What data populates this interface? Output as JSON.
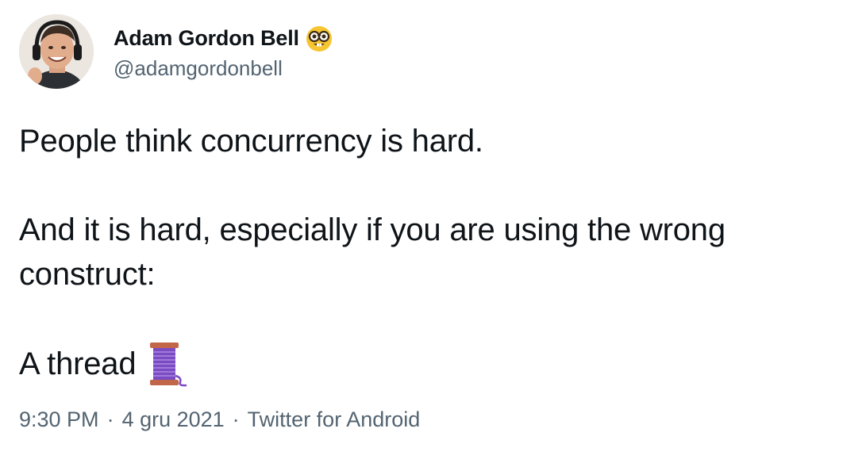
{
  "author": {
    "display_name": "Adam Gordon Bell",
    "handle": "@adamgordonbell",
    "badge_icon": "nerd-face-emoji-icon"
  },
  "tweet": {
    "line1": "People think concurrency is hard.",
    "line2": "And it is hard, especially if you are using the wrong construct:",
    "line3": "A thread",
    "line3_icon": "thread-spool-emoji-icon"
  },
  "meta": {
    "time": "9:30 PM",
    "date": "4 gru 2021",
    "source": "Twitter for Android",
    "separator": "·"
  },
  "colors": {
    "text_primary": "#0f1419",
    "text_secondary": "#536471",
    "spool_thread": "#7b4bc4",
    "spool_wood": "#c2664a"
  }
}
